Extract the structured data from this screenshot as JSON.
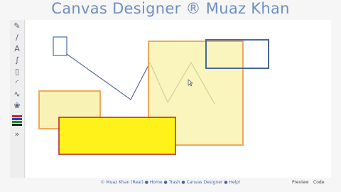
{
  "title": "Canvas Designer ® Muaz Khan",
  "toolbar": {
    "tools": [
      {
        "name": "pencil-tool-icon",
        "glyph": "✎"
      },
      {
        "name": "line-tool-icon",
        "glyph": "∕"
      },
      {
        "name": "text-tool-icon",
        "glyph": "A"
      },
      {
        "name": "bezier-tool-icon",
        "glyph": "∫"
      },
      {
        "name": "rectangle-tool-icon",
        "glyph": "▯"
      },
      {
        "name": "arc-tool-icon",
        "glyph": "◜"
      },
      {
        "name": "quadratic-tool-icon",
        "glyph": "∿"
      },
      {
        "name": "image-tool-icon",
        "glyph": "❀"
      }
    ],
    "colors": [
      "#cc2222",
      "#2244cc",
      "#228833",
      "#222222"
    ],
    "expand_glyph": "»"
  },
  "footer": {
    "links": "© Muaz Khan (Real) ● Home ● Trash ● Canvas Designer ● Help!",
    "preview": "Preview",
    "code": "Code"
  }
}
